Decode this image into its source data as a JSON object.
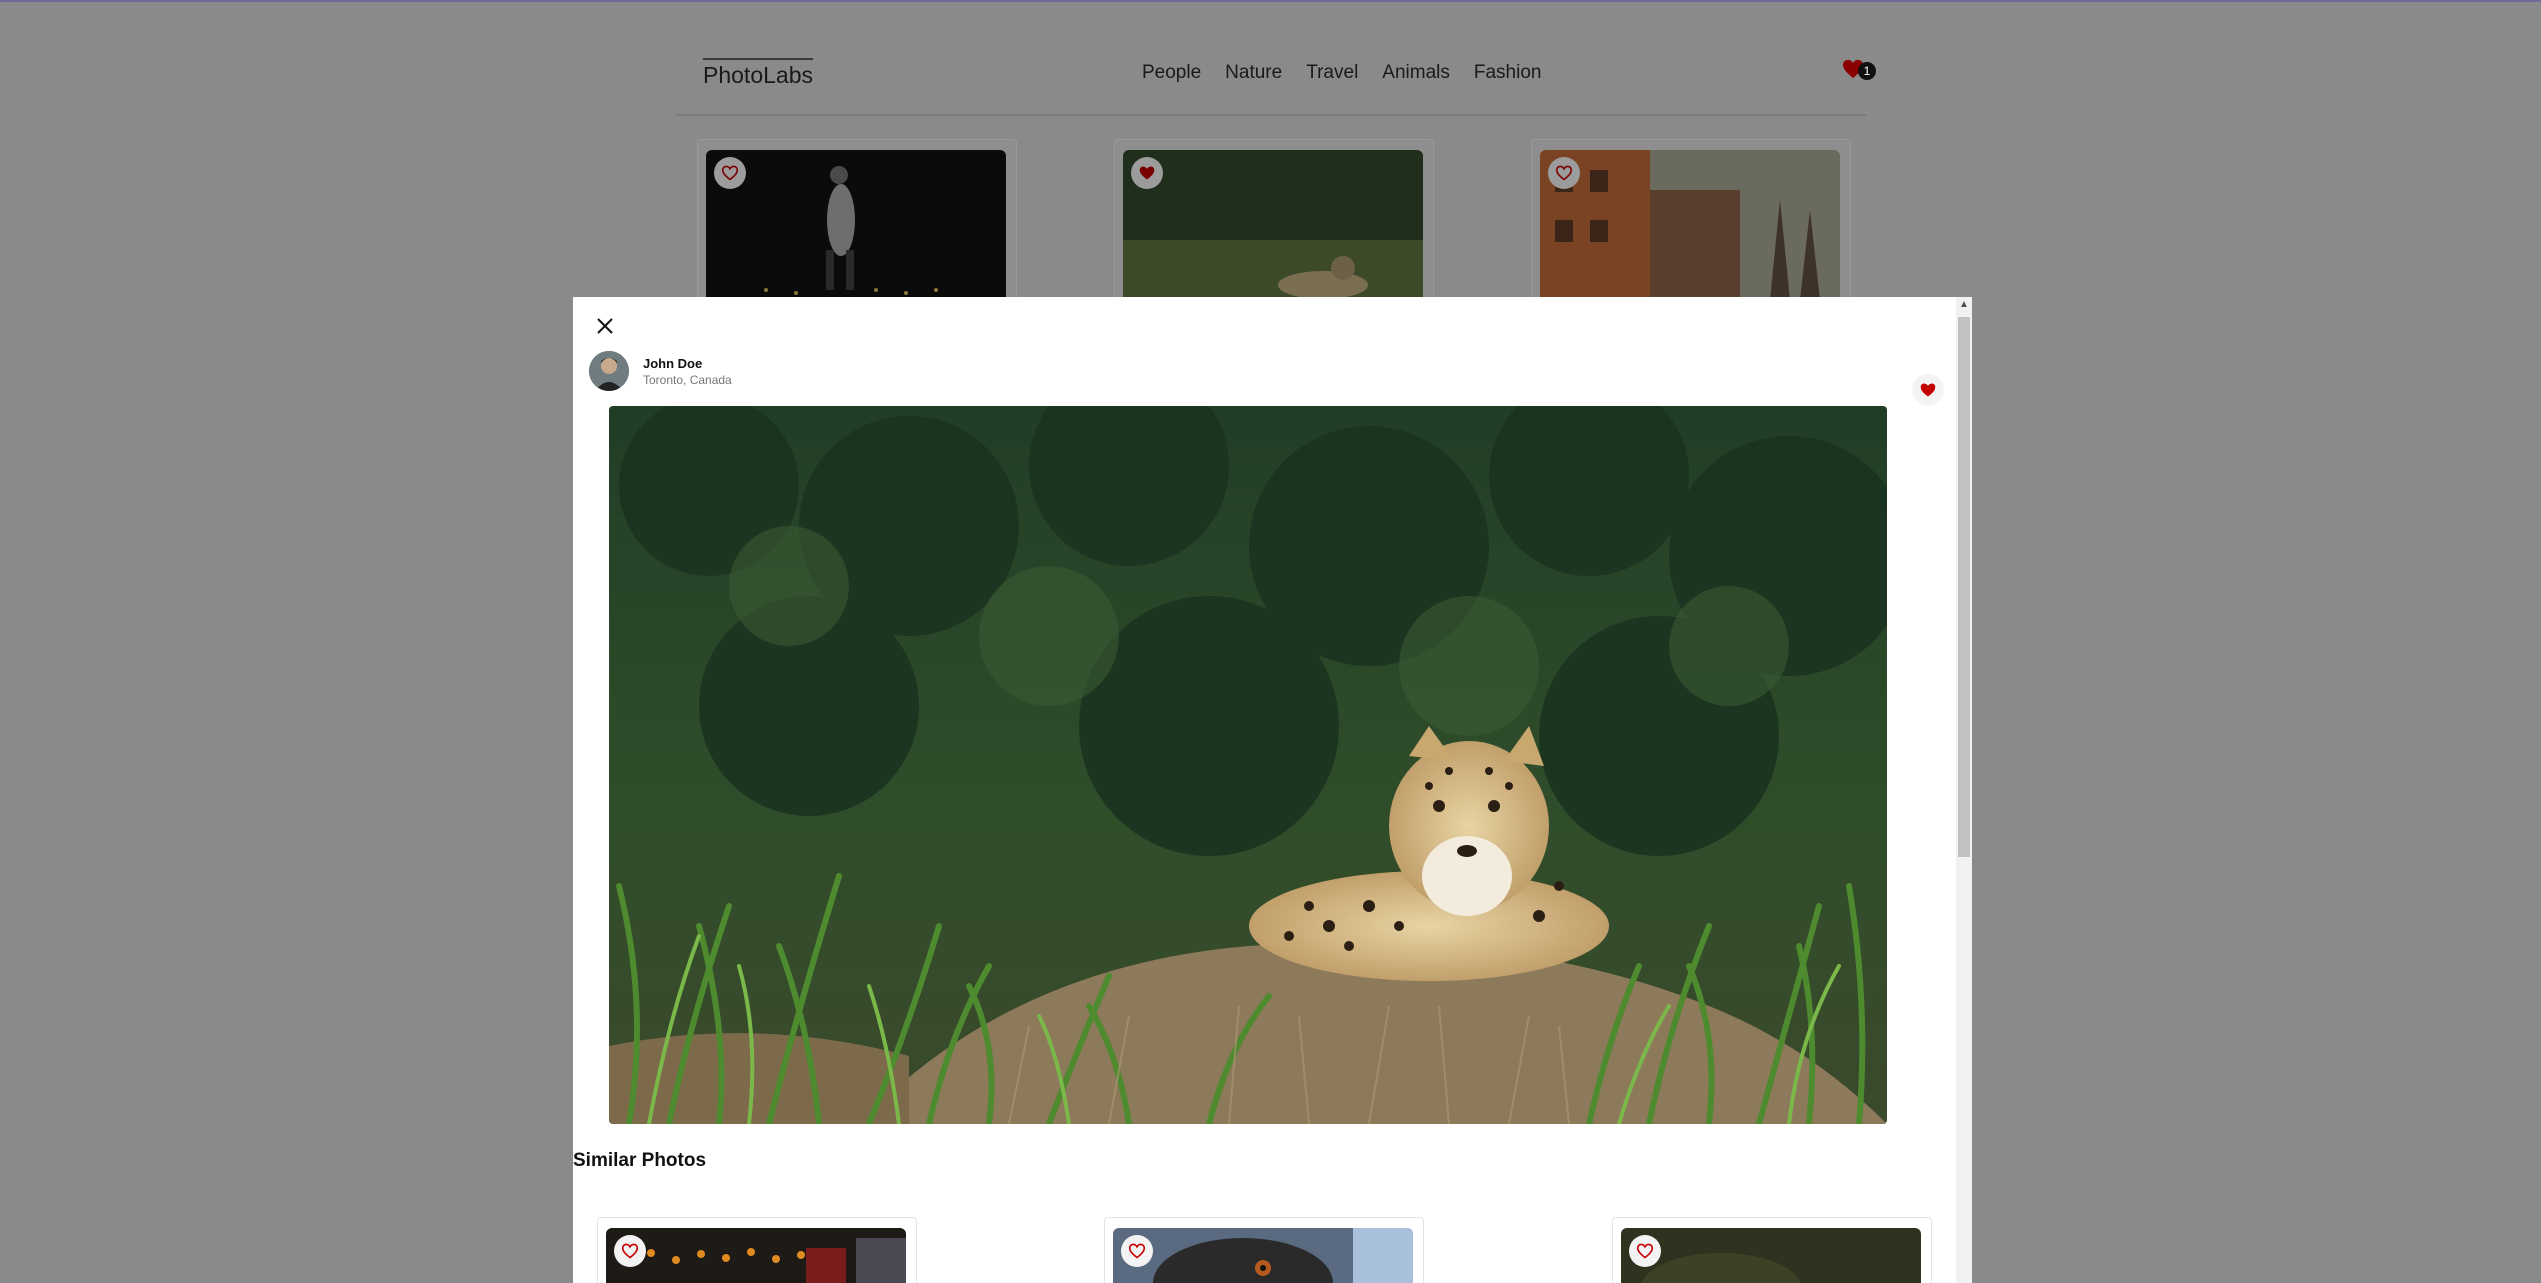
{
  "nav": {
    "logo": "PhotoLabs",
    "topics": [
      "People",
      "Nature",
      "Travel",
      "Animals",
      "Fashion"
    ],
    "fav_count": "1"
  },
  "modal": {
    "user": {
      "name": "John Doe",
      "location": "Toronto, Canada"
    },
    "similar_heading": "Similar Photos"
  },
  "colors": {
    "heart_red": "#c40000",
    "overlay_gray": "#8a8a8a"
  }
}
